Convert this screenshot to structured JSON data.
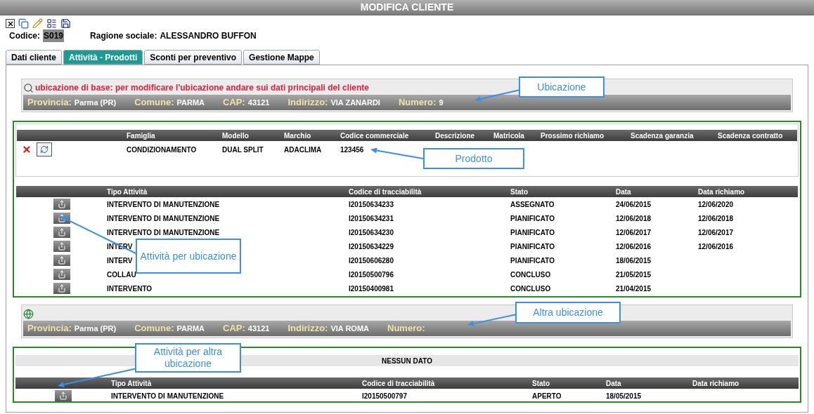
{
  "window": {
    "title": "MODIFICA CLIENTE"
  },
  "client": {
    "code_label": "Codice:",
    "code": "S019",
    "name_label": "Ragione sociale:",
    "name": "ALESSANDRO BUFFON"
  },
  "tabs": [
    {
      "label": "Dati cliente",
      "selected": false
    },
    {
      "label": "Attività - Prodotti",
      "selected": true
    },
    {
      "label": "Sconti per preventivo",
      "selected": false
    },
    {
      "label": "Gestione Mappe",
      "selected": false
    }
  ],
  "base_location": {
    "note": "ubicazione di base: per modificare l'ubicazione andare sui dati principali del cliente",
    "fields": [
      {
        "label": "Provincia:",
        "value": "Parma (PR)"
      },
      {
        "label": "Comune:",
        "value": "PARMA"
      },
      {
        "label": "CAP:",
        "value": "43121"
      },
      {
        "label": "Indirizzo:",
        "value": "VIA ZANARDI"
      },
      {
        "label": "Numero:",
        "value": "9"
      }
    ]
  },
  "products": {
    "columns": [
      "Famiglia",
      "Modello",
      "Marchio",
      "Codice commerciale",
      "Descrizione",
      "Matricola",
      "Prossimo richiamo",
      "Scadenza garanzia",
      "Scadenza contratto"
    ],
    "rows": [
      [
        "CONDIZIONAMENTO",
        "DUAL SPLIT",
        "ADACLIMA",
        "123456"
      ]
    ]
  },
  "activities": {
    "columns": [
      "Tipo Attività",
      "Codice di tracciabilità",
      "Stato",
      "Data",
      "Data richiamo"
    ],
    "rows": [
      [
        "INTERVENTO DI MANUTENZIONE",
        "I20150634233",
        "ASSEGNATO",
        "24/06/2015",
        "12/06/2020"
      ],
      [
        "INTERVENTO DI MANUTENZIONE",
        "I20150634231",
        "PIANIFICATO",
        "12/06/2018",
        "12/06/2018"
      ],
      [
        "INTERVENTO DI MANUTENZIONE",
        "I20150634230",
        "PIANIFICATO",
        "12/06/2017",
        "12/06/2017"
      ],
      [
        "INTERV",
        "I20150634229",
        "PIANIFICATO",
        "12/06/2016",
        "12/06/2016"
      ],
      [
        "INTERV",
        "I20150606280",
        "PIANIFICATO",
        "18/06/2015"
      ],
      [
        "COLLAU",
        "I20150500796",
        "CONCLUSO",
        "21/05/2015"
      ],
      [
        "INTERVENTO",
        "I20150400981",
        "CONCLUSO",
        "21/04/2015"
      ]
    ]
  },
  "other_location": {
    "fields": [
      {
        "label": "Provincia:",
        "value": "Parma (PR)"
      },
      {
        "label": "Comune:",
        "value": "PARMA"
      },
      {
        "label": "CAP:",
        "value": "43121"
      },
      {
        "label": "Indirizzo:",
        "value": "VIA ROMA"
      },
      {
        "label": "Numero:"
      }
    ]
  },
  "other_products": {
    "empty_text": "NESSUN DATO"
  },
  "other_activities": {
    "columns": [
      "Tipo Attività",
      "Codice di tracciabilità",
      "Stato",
      "Data",
      "Data richiamo"
    ],
    "rows": [
      [
        "INTERVENTO DI MANUTENZIONE",
        "I20150500797",
        "APERTO",
        "18/05/2015"
      ]
    ]
  },
  "annotations": [
    {
      "text": "Ubicazione"
    },
    {
      "text": "Prodotto"
    },
    {
      "text": "Attività per ubicazione"
    },
    {
      "text": "Altra ubicazione"
    },
    {
      "text": "Attività per altra ubicazione"
    }
  ]
}
